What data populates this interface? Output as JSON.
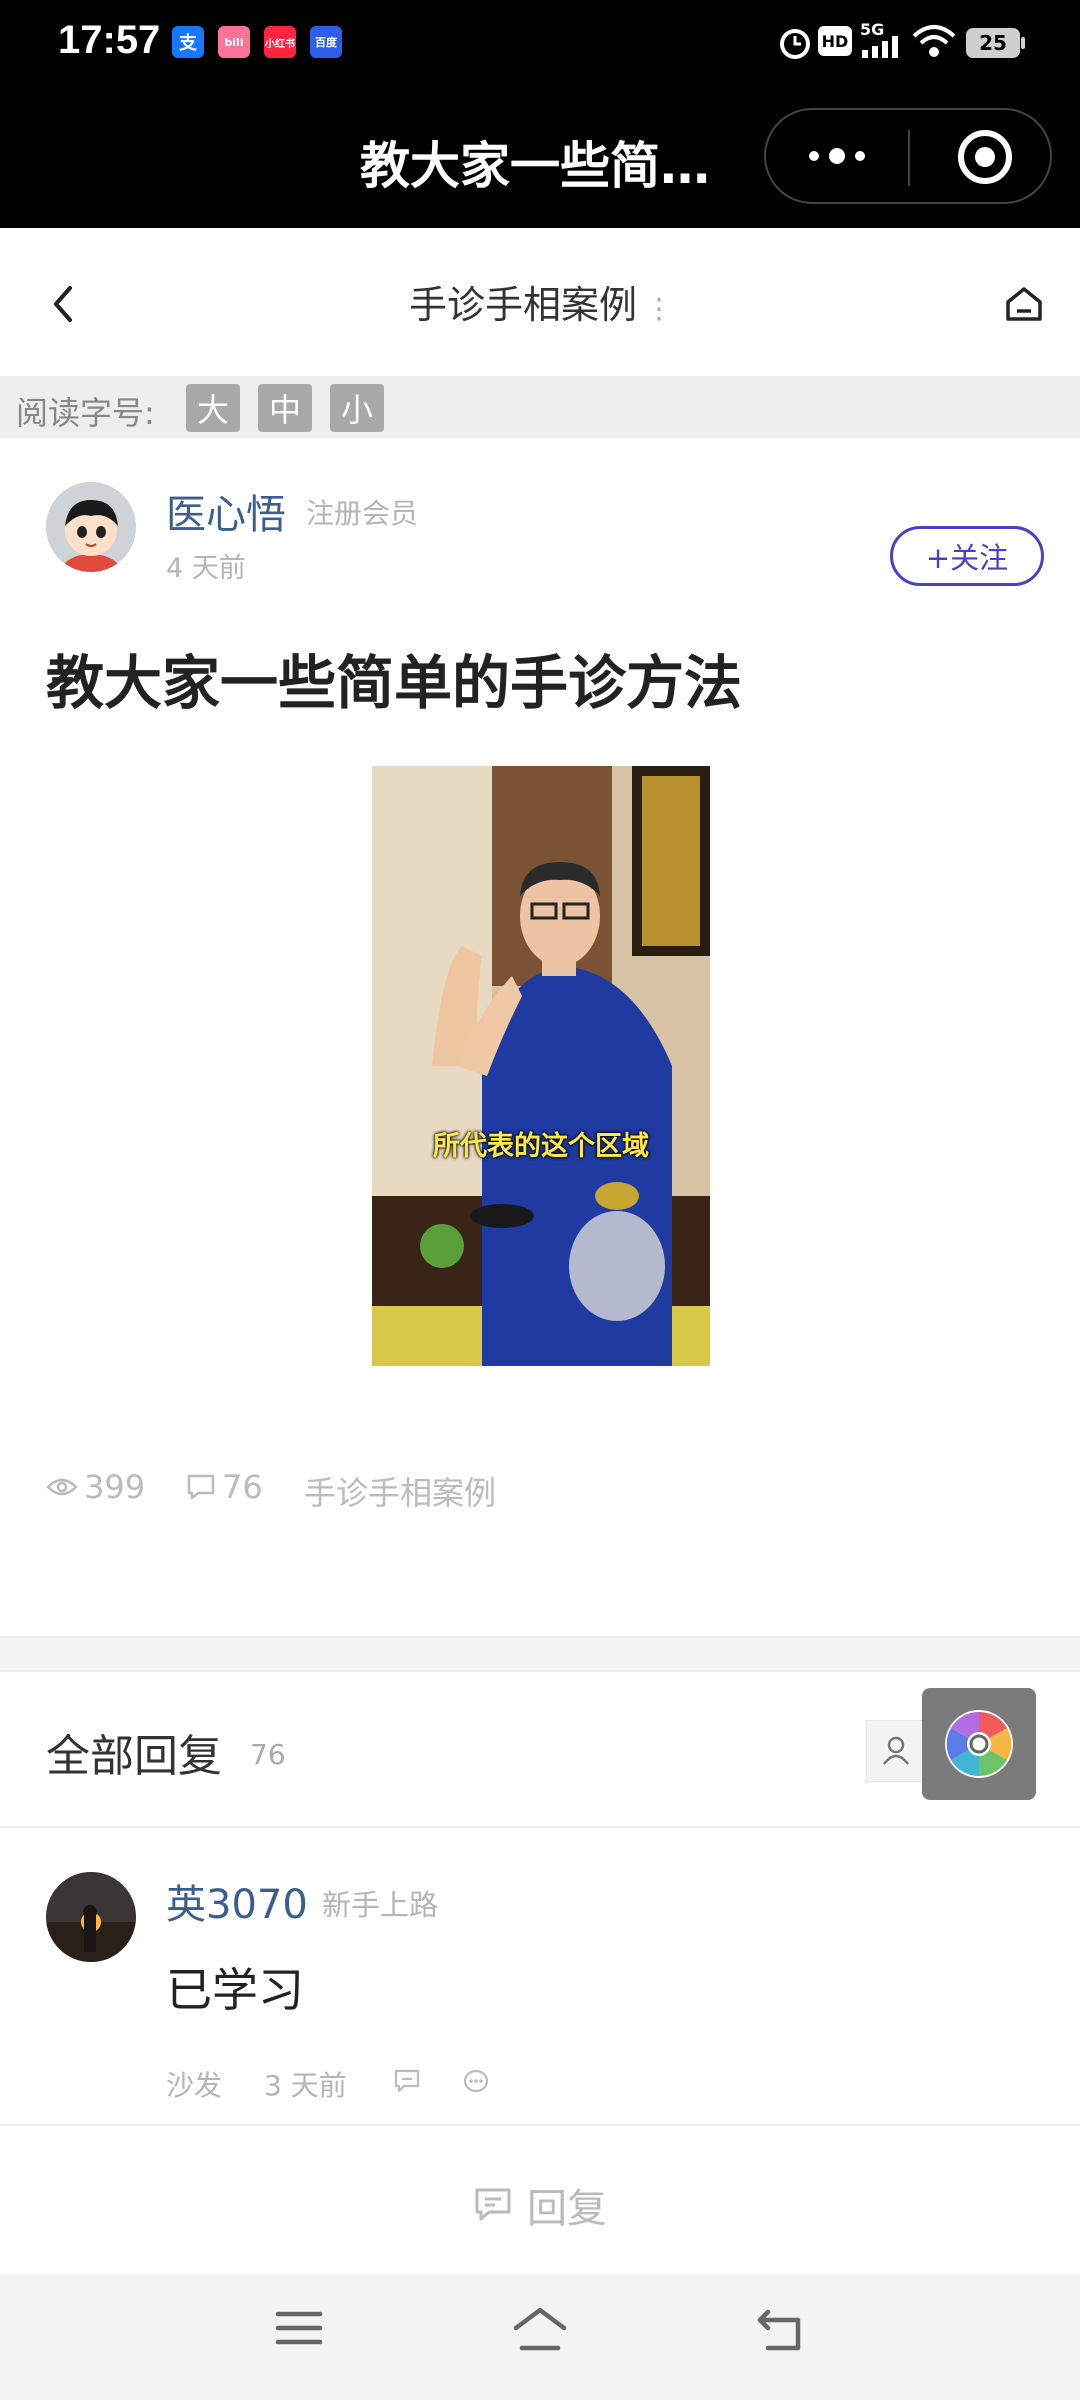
{
  "status_bar": {
    "time": "17:57",
    "app_icons": [
      "支",
      "bili",
      "小红书",
      "百度"
    ],
    "network": "5G",
    "hd": "HD",
    "battery": "25"
  },
  "mini_program": {
    "title": "教大家一些简…"
  },
  "nav": {
    "title": "手诊手相案例",
    "title_dots": "⋮"
  },
  "font_size_bar": {
    "label": "阅读字号:",
    "large": "大",
    "medium": "中",
    "small": "小"
  },
  "author": {
    "name": "医心悟",
    "role": "注册会员",
    "time": "4 天前",
    "follow_label": "+关注"
  },
  "post": {
    "title": "教大家一些简单的手诊方法",
    "video_caption": "所代表的这个区域",
    "views": "399",
    "comments": "76",
    "category": "手诊手相案例"
  },
  "replies": {
    "heading": "全部回复",
    "count": "76",
    "items": [
      {
        "name": "英3070",
        "role": "新手上路",
        "text": "已学习",
        "floor": "沙发",
        "time": "3 天前"
      }
    ],
    "reply_label": "回复"
  },
  "colors": {
    "link_blue": "#3a5f8f",
    "follow_purple": "#4a3fc7",
    "caption_yellow": "#ffe94a"
  }
}
